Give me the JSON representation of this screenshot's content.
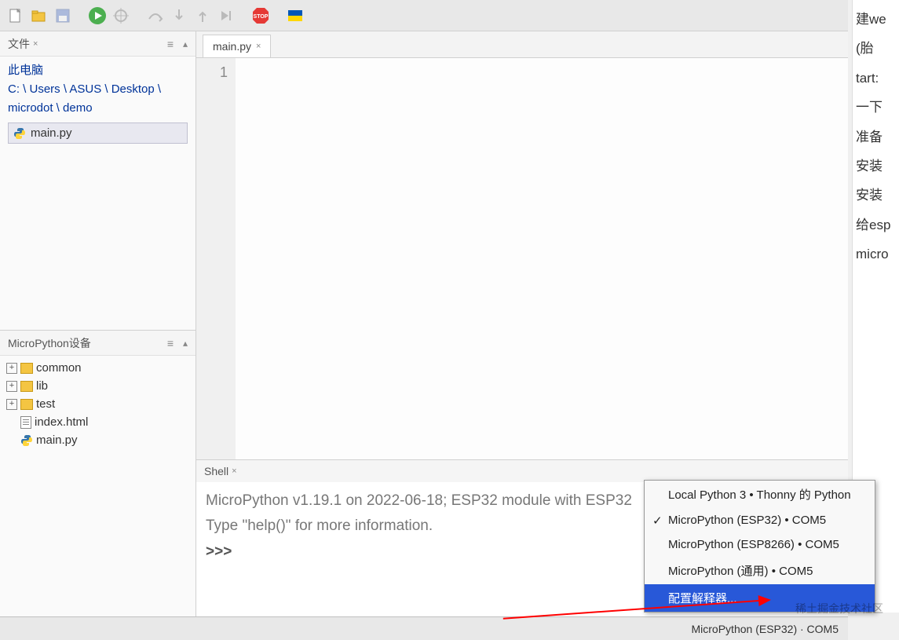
{
  "toolbar": {
    "icons": [
      "new",
      "open",
      "save",
      "run",
      "debug",
      "step",
      "stop",
      "ua"
    ]
  },
  "files_panel": {
    "title": "文件",
    "computer_label": "此电脑",
    "path": "C: \\ Users \\ ASUS \\ Desktop \\ microdot \\ demo",
    "file": "main.py"
  },
  "device_panel": {
    "title": "MicroPython设备",
    "items": [
      {
        "type": "folder",
        "name": "common",
        "expandable": true
      },
      {
        "type": "folder",
        "name": "lib",
        "expandable": true
      },
      {
        "type": "folder",
        "name": "test",
        "expandable": true
      },
      {
        "type": "file",
        "name": "index.html",
        "expandable": false
      },
      {
        "type": "python",
        "name": "main.py",
        "expandable": false
      }
    ]
  },
  "editor": {
    "tab": "main.py",
    "line_number": "1"
  },
  "shell": {
    "title": "Shell",
    "line1": "MicroPython v1.19.1 on 2022-06-18; ESP32 module with ESP32",
    "line2": "Type \"help()\" for more information.",
    "prompt": ">>>"
  },
  "status": {
    "interpreter": "MicroPython (ESP32) · COM5"
  },
  "popup": {
    "items": [
      {
        "label": "Local Python 3  •  Thonny 的 Python",
        "checked": false,
        "selected": false
      },
      {
        "label": "MicroPython (ESP32)  •  COM5",
        "checked": true,
        "selected": false
      },
      {
        "label": "MicroPython (ESP8266)  •  COM5",
        "checked": false,
        "selected": false
      },
      {
        "label": "MicroPython (通用)  •  COM5",
        "checked": false,
        "selected": false
      },
      {
        "label": "配置解释器...",
        "checked": false,
        "selected": true
      }
    ]
  },
  "right_strip": {
    "lines": [
      "建we",
      "(胎",
      "tart:",
      "一下",
      "准备",
      "安装",
      "安装",
      "给esp",
      "micro"
    ]
  },
  "watermark": "稀土掘金技术社区"
}
